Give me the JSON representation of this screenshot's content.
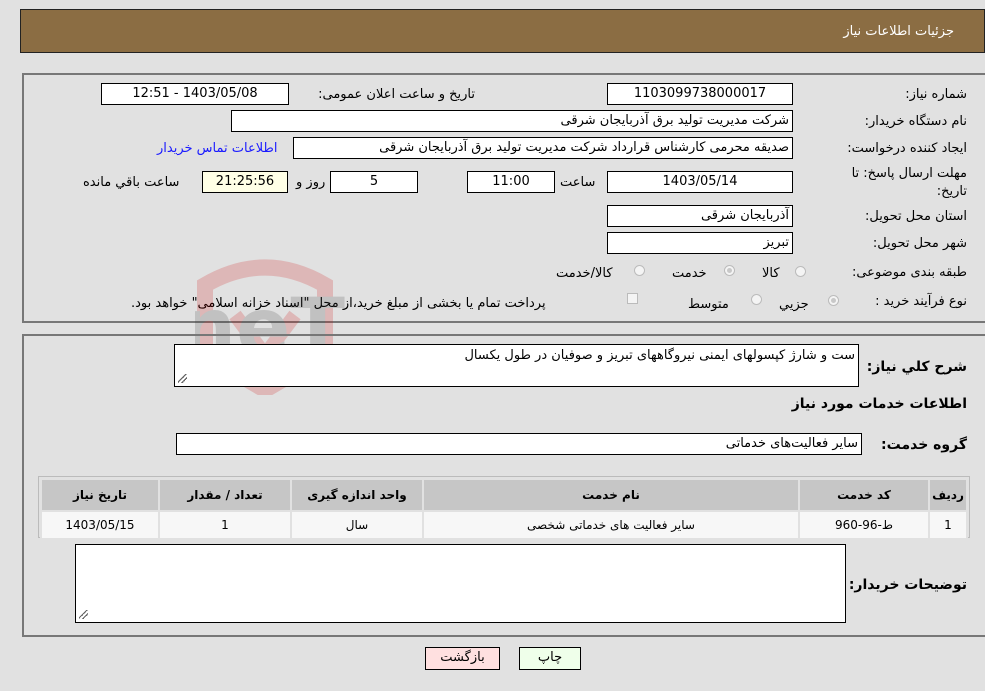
{
  "header": {
    "title": "جزئیات اطلاعات نیاز"
  },
  "fields": {
    "need_number": {
      "label": "شماره نیاز:",
      "value": "1103099738000017"
    },
    "announce_datetime": {
      "label": "تاریخ و ساعت اعلان عمومی:",
      "value": "1403/05/08 - 12:51"
    },
    "buyer_org": {
      "label": "نام دستگاه خریدار:",
      "value": "شرکت مدیریت تولید برق آذربایجان شرقی"
    },
    "requester": {
      "label": "ایجاد کننده درخواست:",
      "value": "صدیقه محرمی کارشناس قرارداد شرکت مدیریت تولید برق آذربایجان شرقی"
    },
    "buyer_contact_link": "اطلاعات تماس خریدار",
    "deadline": {
      "label": "مهلت ارسال پاسخ: تا تاریخ:",
      "date": "1403/05/14",
      "time_label": "ساعت",
      "time": "11:00",
      "days": "5",
      "days_label": "روز و",
      "remaining": "21:25:56",
      "remaining_label": "ساعت باقي مانده"
    },
    "delivery_province": {
      "label": "استان محل تحویل:",
      "value": "آذربایجان شرقی"
    },
    "delivery_city": {
      "label": "شهر محل تحویل:",
      "value": "تبریز"
    },
    "category": {
      "label": "طبقه بندی موضوعی:",
      "options": [
        "کالا",
        "خدمت",
        "کالا/خدمت"
      ],
      "selected": "خدمت"
    },
    "process_type": {
      "label": "نوع فرآیند خرید :",
      "options": [
        "جزيي",
        "متوسط"
      ],
      "selected": "جزيي",
      "treasury_note": "پرداخت تمام یا بخشی از مبلغ خرید،از محل \"اسناد خزانه اسلامی\" خواهد بود."
    }
  },
  "description": {
    "label": "شرح کلي نیاز:",
    "value": "ست و شارژ کپسولهای ایمنی نیروگاههای تبریز و صوفیان در طول یکسال"
  },
  "services_section": {
    "title": "اطلاعات خدمات مورد نیاز",
    "group_label": "گروه خدمت:",
    "group_value": "سایر فعالیت‌های خدماتی"
  },
  "table": {
    "headers": [
      "ردیف",
      "کد خدمت",
      "نام خدمت",
      "واحد اندازه گیری",
      "تعداد / مقدار",
      "تاریخ نیاز"
    ],
    "rows": [
      [
        "1",
        "ط-96-960",
        "سایر فعالیت های خدماتی شخصی",
        "سال",
        "1",
        "1403/05/15"
      ]
    ]
  },
  "buyer_notes": {
    "label": "توضیحات خریدار:",
    "value": ""
  },
  "buttons": {
    "print": "چاپ",
    "back": "بازگشت"
  },
  "watermark": "AriaTender.neT"
}
